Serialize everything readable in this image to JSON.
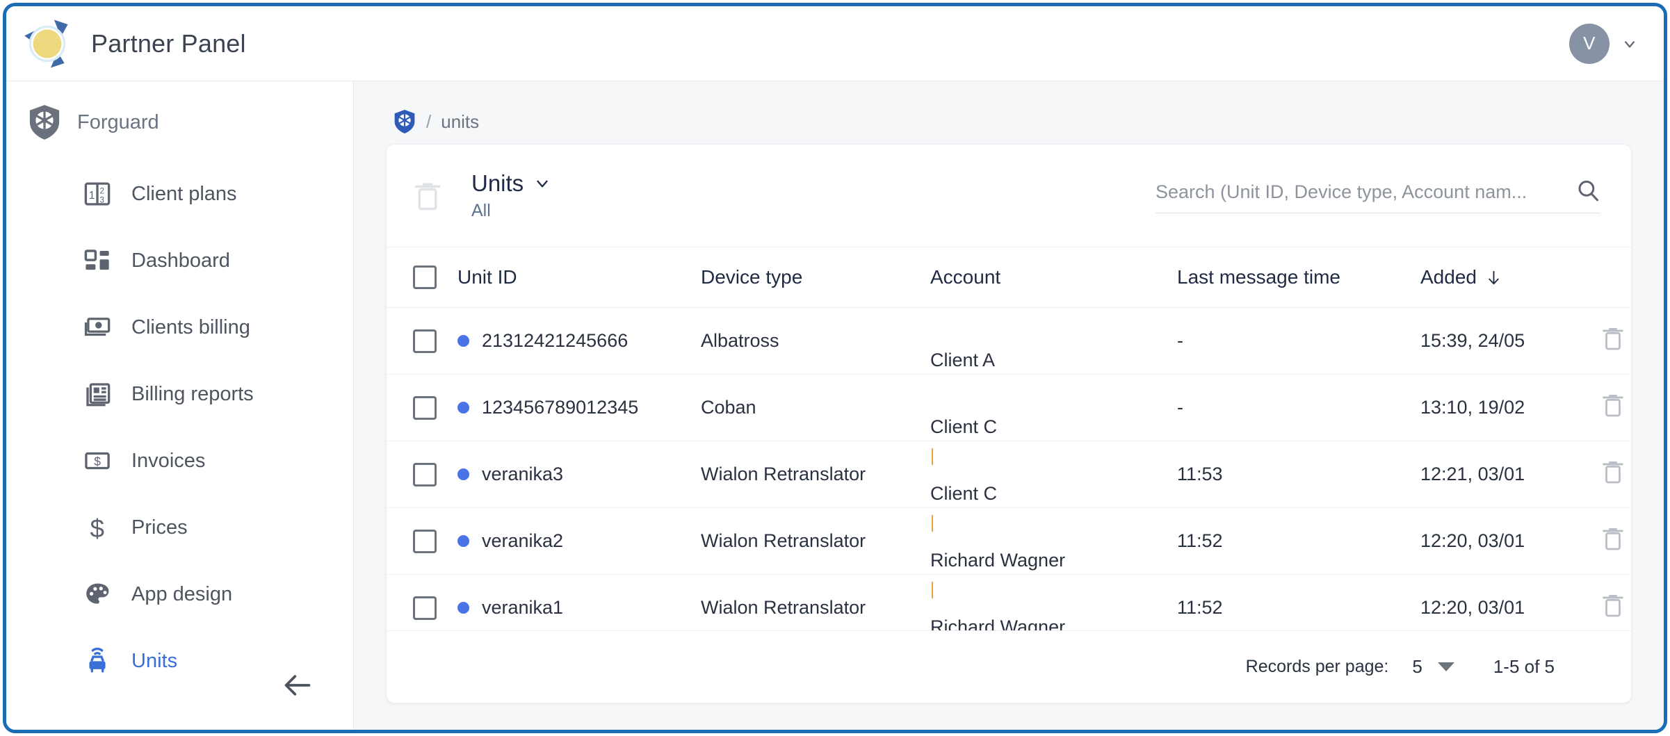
{
  "window": {
    "border_color": "#1a6cb5"
  },
  "topbar": {
    "logo_icon": "lemon-slice-logo",
    "title": "Partner Panel",
    "avatar_initial": "V",
    "avatar_color": "#8792a4",
    "account_chevron_icon": "chevron-down-icon"
  },
  "sidebar": {
    "org": {
      "icon": "shield-wheel-icon",
      "label": "Forguard"
    },
    "items": [
      {
        "icon": "numbers-plan-icon",
        "label": "Client plans",
        "active": false
      },
      {
        "icon": "dashboard-grid-icon",
        "label": "Dashboard",
        "active": false
      },
      {
        "icon": "banknote-icon",
        "label": "Clients billing",
        "active": false
      },
      {
        "icon": "news-report-icon",
        "label": "Billing reports",
        "active": false
      },
      {
        "icon": "invoice-dollar-icon",
        "label": "Invoices",
        "active": false
      },
      {
        "icon": "dollar-sign-icon",
        "label": "Prices",
        "active": false
      },
      {
        "icon": "palette-icon",
        "label": "App design",
        "active": false
      },
      {
        "icon": "connected-car-icon",
        "label": "Units",
        "active": true
      }
    ],
    "collapse_icon": "arrow-left-icon",
    "active_color": "#3a6fd8"
  },
  "breadcrumb": {
    "home_icon": "shield-wheel-icon",
    "separator": "/",
    "current": "units"
  },
  "card": {
    "bulk_delete_icon": "trash-icon",
    "title": "Units",
    "title_chevron_icon": "chevron-down-icon",
    "subtitle": "All",
    "search": {
      "placeholder": "Search (Unit ID, Device type, Account nam...",
      "value": "",
      "icon": "search-icon"
    },
    "table": {
      "select_all_checkbox": "unchecked",
      "columns": [
        {
          "label": ""
        },
        {
          "label": "Unit ID"
        },
        {
          "label": "Device type"
        },
        {
          "label": "Account"
        },
        {
          "label": "Last message time"
        },
        {
          "label": "Added",
          "sort_icon": "arrow-down-icon"
        },
        {
          "label": ""
        }
      ],
      "rows": [
        {
          "checked": false,
          "status_color": "#4c72e8",
          "unit_id": "21312421245666",
          "device_type": "Albatross",
          "account": "Client A",
          "account_marker": false,
          "last_message_time": "-",
          "added": "15:39, 24/05",
          "delete_icon": "trash-icon"
        },
        {
          "checked": false,
          "status_color": "#4c72e8",
          "unit_id": "123456789012345",
          "device_type": "Coban",
          "account": "Client C",
          "account_marker": true,
          "last_message_time": "-",
          "added": "13:10, 19/02",
          "delete_icon": "trash-icon"
        },
        {
          "checked": false,
          "status_color": "#4c72e8",
          "unit_id": "veranika3",
          "device_type": "Wialon Retranslator",
          "account": "Client C",
          "account_marker": true,
          "last_message_time": "11:53",
          "added": "12:21, 03/01",
          "delete_icon": "trash-icon"
        },
        {
          "checked": false,
          "status_color": "#4c72e8",
          "unit_id": "veranika2",
          "device_type": "Wialon Retranslator",
          "account": "Richard Wagner",
          "account_marker": true,
          "last_message_time": "11:52",
          "added": "12:20, 03/01",
          "delete_icon": "trash-icon"
        },
        {
          "checked": false,
          "status_color": "#4c72e8",
          "unit_id": "veranika1",
          "device_type": "Wialon Retranslator",
          "account": "Richard Wagner",
          "account_marker": true,
          "last_message_time": "11:52",
          "added": "12:20, 03/01",
          "delete_icon": "trash-icon"
        }
      ]
    },
    "footer": {
      "records_per_page_label": "Records per page:",
      "records_per_page_value": "5",
      "records_per_page_caret": "caret-down-icon",
      "range": "1-5 of 5"
    }
  }
}
